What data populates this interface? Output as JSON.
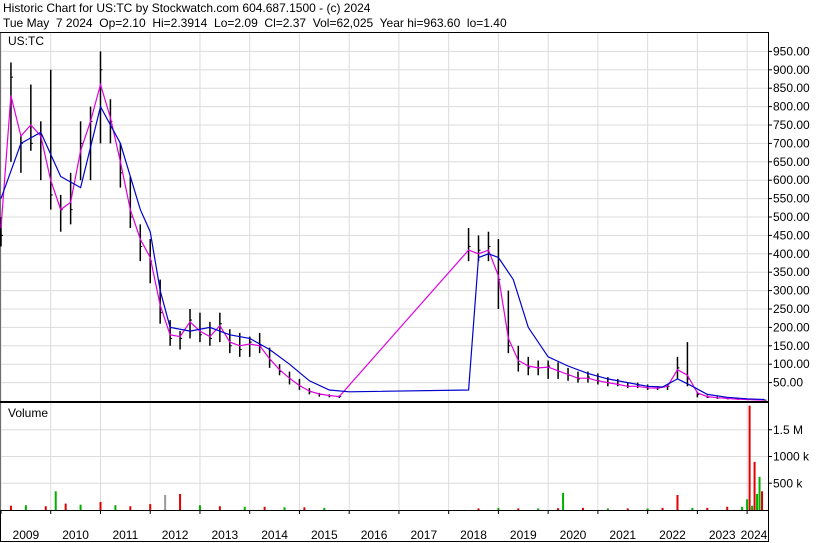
{
  "header": {
    "line1": "Historic Chart for US:TC by Stockwatch.com 604.687.1500 - (c) 2024",
    "line2": "Tue May  7 2024  Op=2.10  Hi=2.3914  Lo=2.09  Cl=2.37  Vol=62,025  Year hi=963.60  lo=1.40"
  },
  "price_panel": {
    "label": "US:TC"
  },
  "volume_panel": {
    "label": "Volume"
  },
  "colors": {
    "price_bars": "#000000",
    "ma_short": "#e000e0",
    "ma_long": "#0000cc",
    "volume_up": "#00b000",
    "volume_down": "#e00000",
    "volume_neutral": "#999999"
  },
  "chart_data": [
    {
      "type": "line",
      "title": "",
      "x_axis": {
        "range": [
          2009.0,
          2024.42
        ],
        "tick_labels": [
          "2009",
          "2010",
          "2011",
          "2012",
          "2013",
          "2014",
          "2015",
          "2016",
          "2017",
          "2018",
          "2019",
          "2020",
          "2021",
          "2022",
          "2023",
          "2024"
        ]
      },
      "y_axis": {
        "range": [
          0,
          1000
        ],
        "tick_values": [
          50,
          100,
          150,
          200,
          250,
          300,
          350,
          400,
          450,
          500,
          550,
          600,
          650,
          700,
          750,
          800,
          850,
          900,
          950
        ],
        "tick_labels": [
          "50.00",
          "100.00",
          "150.00",
          "200.00",
          "250.00",
          "300.00",
          "350.00",
          "400.00",
          "450.00",
          "500.00",
          "550.00",
          "600.00",
          "650.00",
          "700.00",
          "750.00",
          "800.00",
          "850.00",
          "900.00",
          "950.00"
        ]
      },
      "grid": true,
      "series": [
        {
          "style": "price-bars",
          "x": [
            2009.0,
            2009.2,
            2009.4,
            2009.6,
            2009.8,
            2010.0,
            2010.2,
            2010.4,
            2010.6,
            2010.8,
            2011.0,
            2011.2,
            2011.4,
            2011.6,
            2011.8,
            2012.0,
            2012.2,
            2012.4,
            2012.6,
            2012.8,
            2013.0,
            2013.2,
            2013.4,
            2013.6,
            2013.8,
            2014.0,
            2014.2,
            2014.4,
            2014.6,
            2014.8,
            2015.0,
            2015.2,
            2015.4,
            2015.6,
            2015.8,
            2018.4,
            2018.6,
            2018.8,
            2019.0,
            2019.2,
            2019.4,
            2019.6,
            2019.8,
            2020.0,
            2020.2,
            2020.4,
            2020.6,
            2020.8,
            2021.0,
            2021.2,
            2021.4,
            2021.6,
            2021.8,
            2022.0,
            2022.2,
            2022.4,
            2022.6,
            2022.8,
            2023.0,
            2023.2,
            2023.4,
            2023.6,
            2023.8,
            2024.0,
            2024.2,
            2024.35
          ],
          "high": [
            500,
            920,
            720,
            860,
            760,
            900,
            560,
            620,
            760,
            800,
            950,
            820,
            700,
            610,
            480,
            440,
            330,
            220,
            190,
            250,
            240,
            215,
            240,
            195,
            185,
            175,
            185,
            145,
            100,
            80,
            60,
            35,
            22,
            18,
            15,
            470,
            450,
            460,
            440,
            300,
            150,
            120,
            110,
            110,
            105,
            90,
            80,
            80,
            75,
            65,
            60,
            50,
            50,
            45,
            40,
            45,
            120,
            160,
            25,
            15,
            12,
            10,
            8,
            6,
            4,
            2.4
          ],
          "low": [
            420,
            650,
            620,
            680,
            600,
            520,
            460,
            480,
            600,
            600,
            700,
            700,
            580,
            470,
            380,
            320,
            210,
            150,
            140,
            170,
            160,
            150,
            160,
            130,
            120,
            120,
            130,
            90,
            70,
            45,
            30,
            18,
            12,
            10,
            8,
            380,
            380,
            380,
            250,
            130,
            80,
            70,
            70,
            60,
            60,
            55,
            50,
            50,
            45,
            40,
            40,
            35,
            35,
            30,
            30,
            30,
            60,
            40,
            10,
            8,
            6,
            5,
            4,
            3,
            2,
            2.09
          ],
          "close": [
            450,
            880,
            700,
            700,
            720,
            560,
            520,
            520,
            700,
            760,
            900,
            760,
            620,
            500,
            420,
            380,
            240,
            170,
            170,
            220,
            180,
            170,
            210,
            150,
            140,
            160,
            150,
            110,
            80,
            60,
            40,
            25,
            18,
            14,
            12,
            420,
            410,
            420,
            330,
            150,
            100,
            90,
            90,
            95,
            80,
            70,
            60,
            65,
            55,
            50,
            45,
            40,
            40,
            35,
            35,
            40,
            90,
            60,
            18,
            10,
            8,
            6,
            5,
            4,
            3,
            2.37
          ]
        },
        {
          "name": "",
          "style": "ma-short",
          "x": [
            2009.0,
            2009.2,
            2009.4,
            2009.6,
            2009.8,
            2010.0,
            2010.2,
            2010.4,
            2010.6,
            2010.8,
            2011.0,
            2011.2,
            2011.4,
            2011.6,
            2011.8,
            2012.0,
            2012.2,
            2012.4,
            2012.6,
            2012.8,
            2013.0,
            2013.2,
            2013.4,
            2013.6,
            2013.8,
            2014.0,
            2014.2,
            2014.4,
            2014.6,
            2014.8,
            2015.0,
            2015.2,
            2015.4,
            2015.6,
            2015.8,
            2018.4,
            2018.6,
            2018.8,
            2019.0,
            2019.2,
            2019.4,
            2019.6,
            2019.8,
            2020.0,
            2020.2,
            2020.4,
            2020.6,
            2020.8,
            2021.0,
            2021.2,
            2021.4,
            2021.6,
            2021.8,
            2022.0,
            2022.2,
            2022.4,
            2022.6,
            2022.8,
            2023.0,
            2023.2,
            2023.4,
            2023.6,
            2023.8,
            2024.0,
            2024.2,
            2024.35
          ],
          "values": [
            470,
            830,
            720,
            750,
            720,
            600,
            520,
            540,
            680,
            760,
            860,
            770,
            650,
            520,
            440,
            390,
            260,
            180,
            175,
            215,
            190,
            175,
            205,
            160,
            150,
            155,
            150,
            115,
            85,
            62,
            42,
            27,
            19,
            15,
            12,
            410,
            400,
            410,
            340,
            170,
            110,
            95,
            90,
            92,
            82,
            72,
            62,
            62,
            55,
            50,
            45,
            40,
            40,
            36,
            35,
            40,
            85,
            70,
            22,
            12,
            9,
            7,
            5,
            4,
            3,
            2.5
          ]
        },
        {
          "name": "",
          "style": "ma-long",
          "x": [
            2009.0,
            2009.4,
            2009.8,
            2010.2,
            2010.6,
            2011.0,
            2011.4,
            2011.8,
            2012.0,
            2012.2,
            2012.4,
            2012.8,
            2013.2,
            2013.6,
            2014.0,
            2014.4,
            2014.8,
            2015.2,
            2015.6,
            2016.0,
            2018.4,
            2018.6,
            2018.8,
            2019.0,
            2019.3,
            2019.6,
            2020.0,
            2020.4,
            2020.8,
            2021.2,
            2021.6,
            2022.0,
            2022.3,
            2022.6,
            2022.9,
            2023.2,
            2023.6,
            2024.0,
            2024.35
          ],
          "values": [
            550,
            700,
            730,
            610,
            580,
            800,
            700,
            520,
            460,
            300,
            200,
            190,
            200,
            180,
            170,
            140,
            100,
            55,
            30,
            25,
            30,
            390,
            400,
            390,
            330,
            200,
            120,
            95,
            75,
            60,
            50,
            40,
            38,
            60,
            40,
            18,
            10,
            6,
            4
          ]
        }
      ]
    },
    {
      "type": "bar",
      "title": "",
      "x_axis": {
        "range": [
          2009.0,
          2024.42
        ],
        "tick_labels": [
          "2009",
          "2010",
          "2011",
          "2012",
          "2013",
          "2014",
          "2015",
          "2016",
          "2017",
          "2018",
          "2019",
          "2020",
          "2021",
          "2022",
          "2023",
          "2024"
        ]
      },
      "y_axis": {
        "range": [
          0,
          2000000
        ],
        "tick_values": [
          500000,
          1000000,
          1500000
        ],
        "tick_labels": [
          "500 k",
          "1000 k",
          "1.5 M"
        ]
      },
      "grid": true,
      "series": [
        {
          "name": "Volume",
          "x": [
            2009.2,
            2009.5,
            2009.9,
            2010.1,
            2010.3,
            2010.6,
            2011.0,
            2011.3,
            2011.6,
            2012.0,
            2012.3,
            2012.6,
            2013.0,
            2013.4,
            2013.9,
            2014.3,
            2014.7,
            2015.1,
            2015.5,
            2018.6,
            2019.0,
            2019.4,
            2019.8,
            2020.2,
            2020.3,
            2020.7,
            2021.2,
            2021.6,
            2022.0,
            2022.3,
            2022.6,
            2022.9,
            2023.2,
            2023.6,
            2023.9,
            2024.0,
            2024.05,
            2024.1,
            2024.15,
            2024.2,
            2024.25,
            2024.3
          ],
          "values": [
            80000,
            90000,
            70000,
            350000,
            120000,
            100000,
            150000,
            90000,
            70000,
            110000,
            280000,
            300000,
            90000,
            70000,
            60000,
            60000,
            50000,
            50000,
            40000,
            30000,
            40000,
            30000,
            30000,
            35000,
            320000,
            40000,
            30000,
            30000,
            30000,
            40000,
            280000,
            40000,
            40000,
            60000,
            60000,
            200000,
            1950000,
            80000,
            900000,
            300000,
            620000,
            350000
          ],
          "direction": [
            "down",
            "up",
            "down",
            "up",
            "down",
            "up",
            "down",
            "up",
            "down",
            "down",
            "neutral",
            "down",
            "up",
            "down",
            "up",
            "down",
            "up",
            "down",
            "up",
            "down",
            "up",
            "down",
            "up",
            "down",
            "up",
            "down",
            "up",
            "down",
            "up",
            "down",
            "down",
            "up",
            "down",
            "down",
            "up",
            "up",
            "down",
            "up",
            "down",
            "up",
            "up",
            "down"
          ]
        }
      ]
    }
  ]
}
